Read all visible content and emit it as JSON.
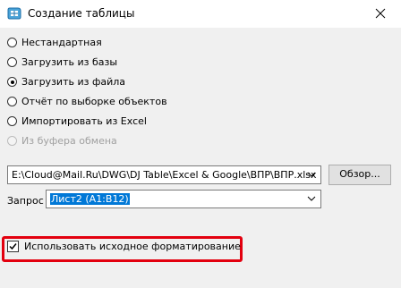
{
  "window": {
    "title": "Создание таблицы",
    "icon": "table-app-icon",
    "close_icon": "close-icon"
  },
  "source_options": [
    {
      "label": "Нестандартная",
      "selected": false,
      "enabled": true
    },
    {
      "label": "Загрузить из базы",
      "selected": false,
      "enabled": true
    },
    {
      "label": "Загрузить из файла",
      "selected": true,
      "enabled": true
    },
    {
      "label": "Отчёт по выборке объектов",
      "selected": false,
      "enabled": true
    },
    {
      "label": "Импортировать из Excel",
      "selected": false,
      "enabled": true
    },
    {
      "label": "Из буфера обмена",
      "selected": false,
      "enabled": false
    }
  ],
  "file": {
    "path_value": "E:\\Cloud@Mail.Ru\\DWG\\DJ Table\\Excel & Google\\ВПР\\ВПР.xlsx",
    "browse_label": "Обзор..."
  },
  "query": {
    "label": "Запрос",
    "value": "Лист2 (A1:B12)"
  },
  "formatting": {
    "label": "Использовать исходное форматирование",
    "checked": true
  },
  "colors": {
    "highlight": "#e3000f",
    "selection": "#0078d7",
    "panel": "#f0f0f0"
  }
}
